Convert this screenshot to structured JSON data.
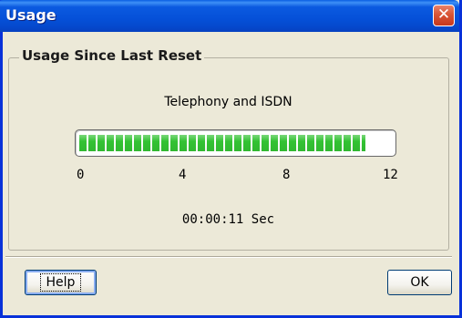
{
  "window": {
    "title": "Usage"
  },
  "group": {
    "label": "Usage Since Last Reset"
  },
  "usage": {
    "label": "Telephony and ISDN",
    "ticks": [
      "0",
      "4",
      "8",
      "12"
    ],
    "max": 12,
    "value": 11,
    "elapsed": "00:00:11 Sec"
  },
  "buttons": {
    "help": "Help",
    "ok": "OK"
  },
  "icons": {
    "close": "close-icon"
  },
  "colors": {
    "titlebar": "#0550d8",
    "progress": "#33c233",
    "background": "#ece9d8"
  }
}
